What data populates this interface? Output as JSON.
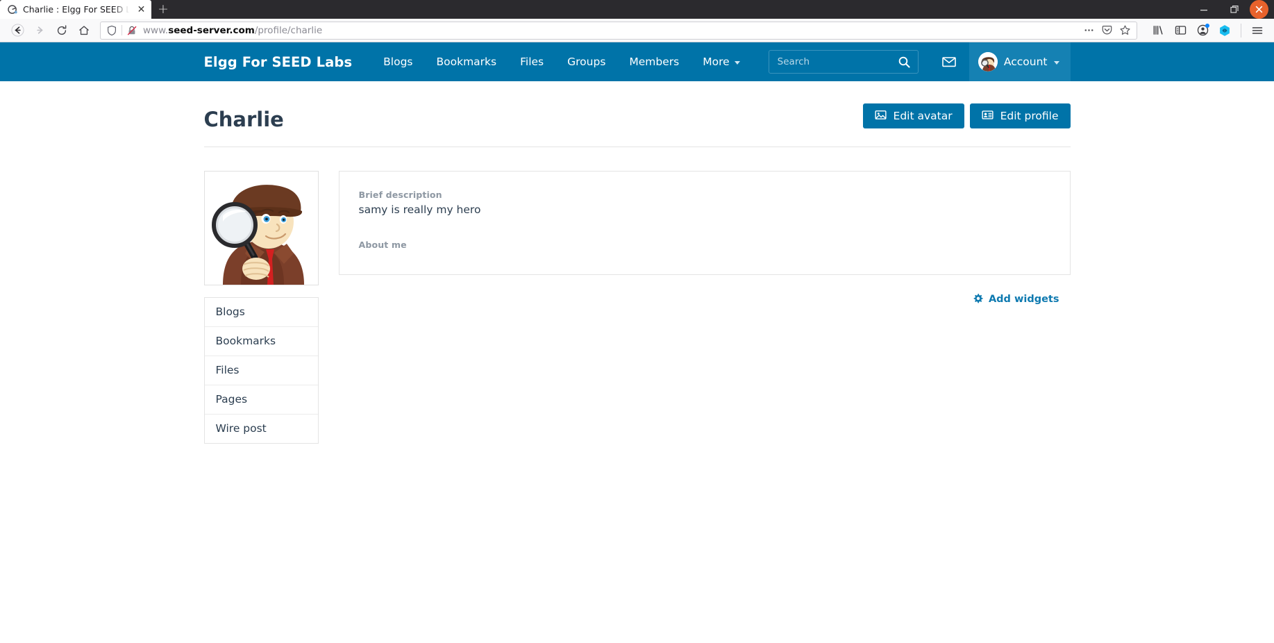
{
  "browser": {
    "tab": {
      "title": "Charlie : Elgg For SEED L",
      "favicon_name": "elgg-favicon",
      "close_label": "✕"
    },
    "newtab_label": "+",
    "window_controls": {
      "minimize": "–",
      "restore": "❐",
      "close": "✕"
    },
    "nav": {
      "back": "←",
      "forward": "→",
      "reload": "⟳",
      "home": "⌂"
    },
    "url": {
      "prefix": "www.",
      "domain": "seed-server.com",
      "path": "/profile/charlie",
      "full": "www.seed-server.com/profile/charlie",
      "shield_icon": "tracking-protection-shield-icon",
      "insecure_icon": "broken-lock-icon"
    },
    "url_actions": {
      "page_actions": "•••",
      "pocket": "pocket-icon",
      "bookmark": "star-icon"
    },
    "toolbar_icons": {
      "library": "library-icon",
      "sidebar": "sidebar-icon",
      "account": "account-icon",
      "extension": "extension-hexagon-icon",
      "menu": "hamburger-menu-icon"
    }
  },
  "site": {
    "brand": "Elgg For SEED Labs",
    "nav_items": [
      {
        "label": "Blogs",
        "has_caret": false
      },
      {
        "label": "Bookmarks",
        "has_caret": false
      },
      {
        "label": "Files",
        "has_caret": false
      },
      {
        "label": "Groups",
        "has_caret": false
      },
      {
        "label": "Members",
        "has_caret": false
      },
      {
        "label": "More",
        "has_caret": true
      }
    ],
    "search": {
      "placeholder": "Search",
      "value": "",
      "button_icon": "search-icon"
    },
    "mail_icon": "envelope-icon",
    "account": {
      "label": "Account",
      "avatar_name": "detective-avatar-thumb",
      "caret": true
    },
    "accent_color": "#0073a8",
    "accent_active_color": "#1581b3"
  },
  "profile": {
    "title": "Charlie",
    "actions": [
      {
        "label": "Edit avatar",
        "icon": "image-icon"
      },
      {
        "label": "Edit profile",
        "icon": "id-card-icon"
      }
    ],
    "avatar_name": "detective-avatar-large",
    "menu": [
      {
        "label": "Blogs"
      },
      {
        "label": "Bookmarks"
      },
      {
        "label": "Files"
      },
      {
        "label": "Pages"
      },
      {
        "label": "Wire post"
      }
    ],
    "fields": [
      {
        "label": "Brief description",
        "value": "samy is really my hero"
      },
      {
        "label": "About me",
        "value": ""
      }
    ],
    "add_widgets": {
      "label": "Add widgets",
      "icon": "gear-icon"
    }
  }
}
